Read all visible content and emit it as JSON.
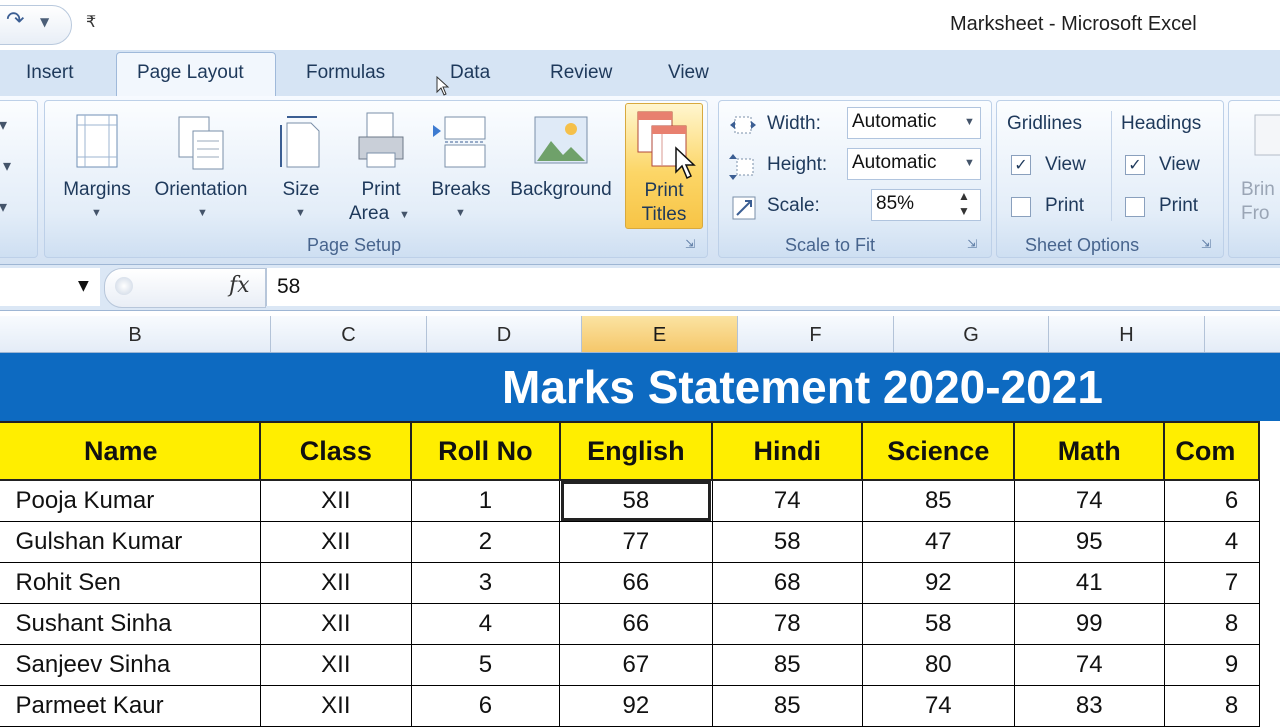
{
  "window": {
    "title": "Marksheet - Microsoft Excel"
  },
  "tabs": [
    {
      "label": "Insert"
    },
    {
      "label": "Page Layout",
      "active": true
    },
    {
      "label": "Formulas"
    },
    {
      "label": "Data"
    },
    {
      "label": "Review"
    },
    {
      "label": "View"
    }
  ],
  "ribbon": {
    "page_setup": {
      "label": "Page Setup",
      "margins": "Margins",
      "orientation": "Orientation",
      "size": "Size",
      "print_area_1": "Print",
      "print_area_2": "Area",
      "breaks": "Breaks",
      "background": "Background",
      "print_titles_1": "Print",
      "print_titles_2": "Titles"
    },
    "scale_to_fit": {
      "label": "Scale to Fit",
      "width_label": "Width:",
      "width_value": "Automatic",
      "height_label": "Height:",
      "height_value": "Automatic",
      "scale_label": "Scale:",
      "scale_value": "85%"
    },
    "sheet_options": {
      "label": "Sheet Options",
      "gridlines": "Gridlines",
      "headings": "Headings",
      "view": "View",
      "print": "Print"
    },
    "arrange": {
      "bring_1": "Brin",
      "bring_2": "Fro"
    }
  },
  "formula_bar": {
    "fx": "fx",
    "value": "58"
  },
  "columns": [
    "B",
    "C",
    "D",
    "E",
    "F",
    "G",
    "H"
  ],
  "sheet": {
    "title": "Marks Statement 2020-2021",
    "headers": [
      "Name",
      "Class",
      "Roll No",
      "English",
      "Hindi",
      "Science",
      "Math",
      "Com"
    ],
    "rows": [
      [
        "Pooja Kumar",
        "XII",
        "1",
        "58",
        "74",
        "85",
        "74",
        "6"
      ],
      [
        "Gulshan Kumar",
        "XII",
        "2",
        "77",
        "58",
        "47",
        "95",
        "4"
      ],
      [
        "Rohit Sen",
        "XII",
        "3",
        "66",
        "68",
        "92",
        "41",
        "7"
      ],
      [
        "Sushant Sinha",
        "XII",
        "4",
        "66",
        "78",
        "58",
        "99",
        "8"
      ],
      [
        "Sanjeev Sinha",
        "XII",
        "5",
        "67",
        "85",
        "80",
        "74",
        "9"
      ],
      [
        "Parmeet Kaur",
        "XII",
        "6",
        "92",
        "85",
        "74",
        "83",
        "8"
      ]
    ]
  }
}
